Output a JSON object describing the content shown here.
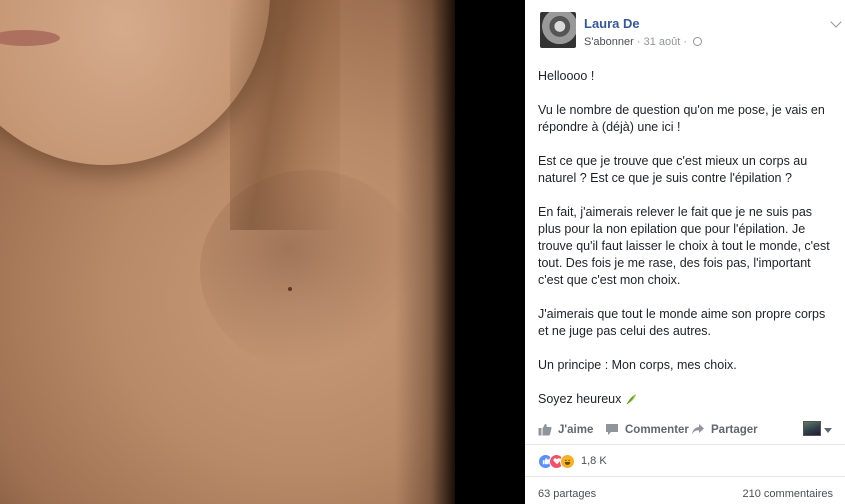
{
  "post": {
    "author": "Laura De",
    "subscribe_label": "S'abonner",
    "separator": "·",
    "date": "31 août",
    "separator2": "·",
    "paragraphs": [
      "Helloooo !",
      "Vu le nombre de question qu'on me pose, je vais en répondre à (déjà) une ici !",
      "Est ce que je trouve que c'est mieux un corps au naturel ? Est ce que je suis contre l'épilation ?",
      "En fait, j'aimerais relever le fait que je ne suis pas plus pour la non epilation que pour l'épilation. Je trouve qu'il faut laisser le choix à tout le monde, c'est tout. Des fois je me rase, des fois pas, l'important c'est que c'est mon choix.",
      "J'aimerais que tout le monde aime son propre corps et ne juge pas celui des autres.",
      "Un principe : Mon corps, mes choix."
    ],
    "closing": "Soyez heureux"
  },
  "actions": {
    "like": "J'aime",
    "comment": "Commenter",
    "share": "Partager"
  },
  "stats": {
    "reactions_count": "1,8 K",
    "shares": "63 partages",
    "comments": "210 commentaires"
  },
  "colors": {
    "link_blue": "#365899",
    "muted": "#90949c",
    "like_blue": "#5890ff",
    "love_red": "#f25268",
    "haha_yellow": "#f7b125"
  },
  "icons": [
    "chevron-down-icon",
    "globe-icon",
    "thumbs-up-icon",
    "comment-icon",
    "share-icon",
    "leaf-emoji-icon"
  ]
}
